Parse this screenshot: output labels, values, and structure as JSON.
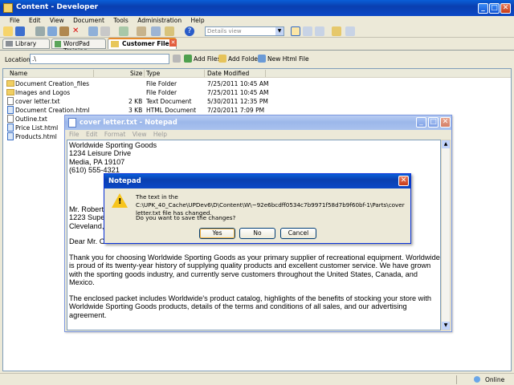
{
  "main_window": {
    "title": "Content - Developer",
    "menu": [
      "File",
      "Edit",
      "View",
      "Document",
      "Tools",
      "Administration",
      "Help"
    ],
    "view_select": "Details view",
    "tabs": [
      "Library",
      "WordPad Training",
      "Customer Files"
    ],
    "location_label": "Location:",
    "location_value": ".\\",
    "add_files": "Add Files",
    "add_folder": "Add Folder",
    "new_html_file": "New Html File",
    "columns": {
      "name": "Name",
      "size": "Size",
      "type": "Type",
      "date": "Date Modified"
    },
    "rows": [
      {
        "name": "Document Creation_files",
        "size": "",
        "type": "File Folder",
        "date": "7/25/2011 10:45 AM"
      },
      {
        "name": "Images and Logos",
        "size": "",
        "type": "File Folder",
        "date": "7/25/2011 10:45 AM"
      },
      {
        "name": "cover letter.txt",
        "size": "2 KB",
        "type": "Text Document",
        "date": "5/30/2011 12:35 PM"
      },
      {
        "name": "Document Creation.html",
        "size": "3 KB",
        "type": "HTML Document",
        "date": "7/20/2011 7:09 PM"
      },
      {
        "name": "Outline.txt",
        "size": "",
        "type": "",
        "date": ""
      },
      {
        "name": "Price List.html",
        "size": "",
        "type": "",
        "date": ""
      },
      {
        "name": "Products.html",
        "size": "",
        "type": "",
        "date": ""
      }
    ],
    "status": "Online"
  },
  "notepad": {
    "title": "cover letter.txt - Notepad",
    "menu": [
      "File",
      "Edit",
      "Format",
      "View",
      "Help"
    ],
    "address": [
      "Worldwide Sporting Goods",
      "1234 Leisure Drive",
      "Media, PA 19107",
      "(610) 555-4321"
    ],
    "recipient_partial": [
      "Mr. Robert",
      "1223 Supe",
      "Cleveland,"
    ],
    "salutation_partial": "Dear Mr. C",
    "paragraph1": "Thank you for choosing Worldwide Sporting Goods as your primary supplier of recreational equipment. Worldwide is proud of its twenty-year history of supplying quality products and excellent customer service. We have grown with the sporting goods industry, and currently serve customers throughout the United States, Canada, and Mexico.",
    "paragraph2": "The enclosed packet includes Worldwide's product catalog, highlights of the benefits of stocking your store with Worldwide Sporting Goods products, details of the terms and conditions of all sales, and our advertising agreement."
  },
  "dialog": {
    "title": "Notepad",
    "message": "The text in the C:\\UPK_40_Cache\\UPDev6\\D\\Content\\W\\~92e6bcdff0534c7b9971f58d7b9f60bf-1\\Parts\\cover letter.txt file has changed.",
    "question": "Do you want to save the changes?",
    "yes": "Yes",
    "no": "No",
    "cancel": "Cancel"
  }
}
